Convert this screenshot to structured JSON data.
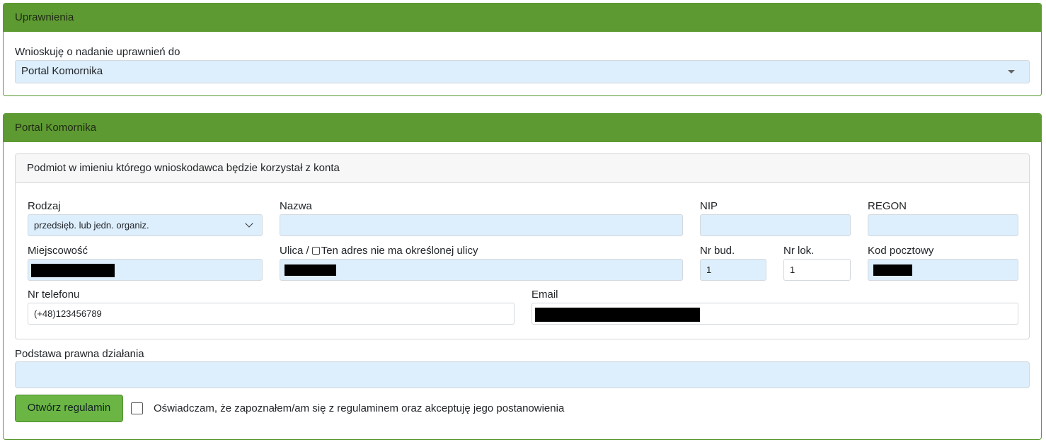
{
  "uprawnienia": {
    "title": "Uprawnienia",
    "request_label": "Wnioskuję o nadanie uprawnień do",
    "request_value": "Portal Komornika"
  },
  "portal": {
    "title": "Portal Komornika",
    "subject": {
      "title": "Podmiot w imieniu którego wnioskodawca będzie korzystał z konta",
      "rodzaj_label": "Rodzaj",
      "rodzaj_value": "przedsięb. lub jedn. organiz.",
      "nazwa_label": "Nazwa",
      "nip_label": "NIP",
      "regon_label": "REGON",
      "miejscowosc_label": "Miejscowość",
      "ulica_label": "Ulica /",
      "no_street_label": "Ten adres nie ma określonej ulicy",
      "nr_bud_label": "Nr bud.",
      "nr_bud_value": "1",
      "nr_lok_label": "Nr lok.",
      "nr_lok_value": "1",
      "kod_label": "Kod pocztowy",
      "telefon_label": "Nr telefonu",
      "telefon_value": "(+48)123456789",
      "email_label": "Email"
    },
    "podstawa_label": "Podstawa prawna działania",
    "regulamin_button": "Otwórz regulamin",
    "accept_label": "Oświadczam, że zapoznałem/am się z regulaminem oraz akceptuję jego postanowienia"
  }
}
